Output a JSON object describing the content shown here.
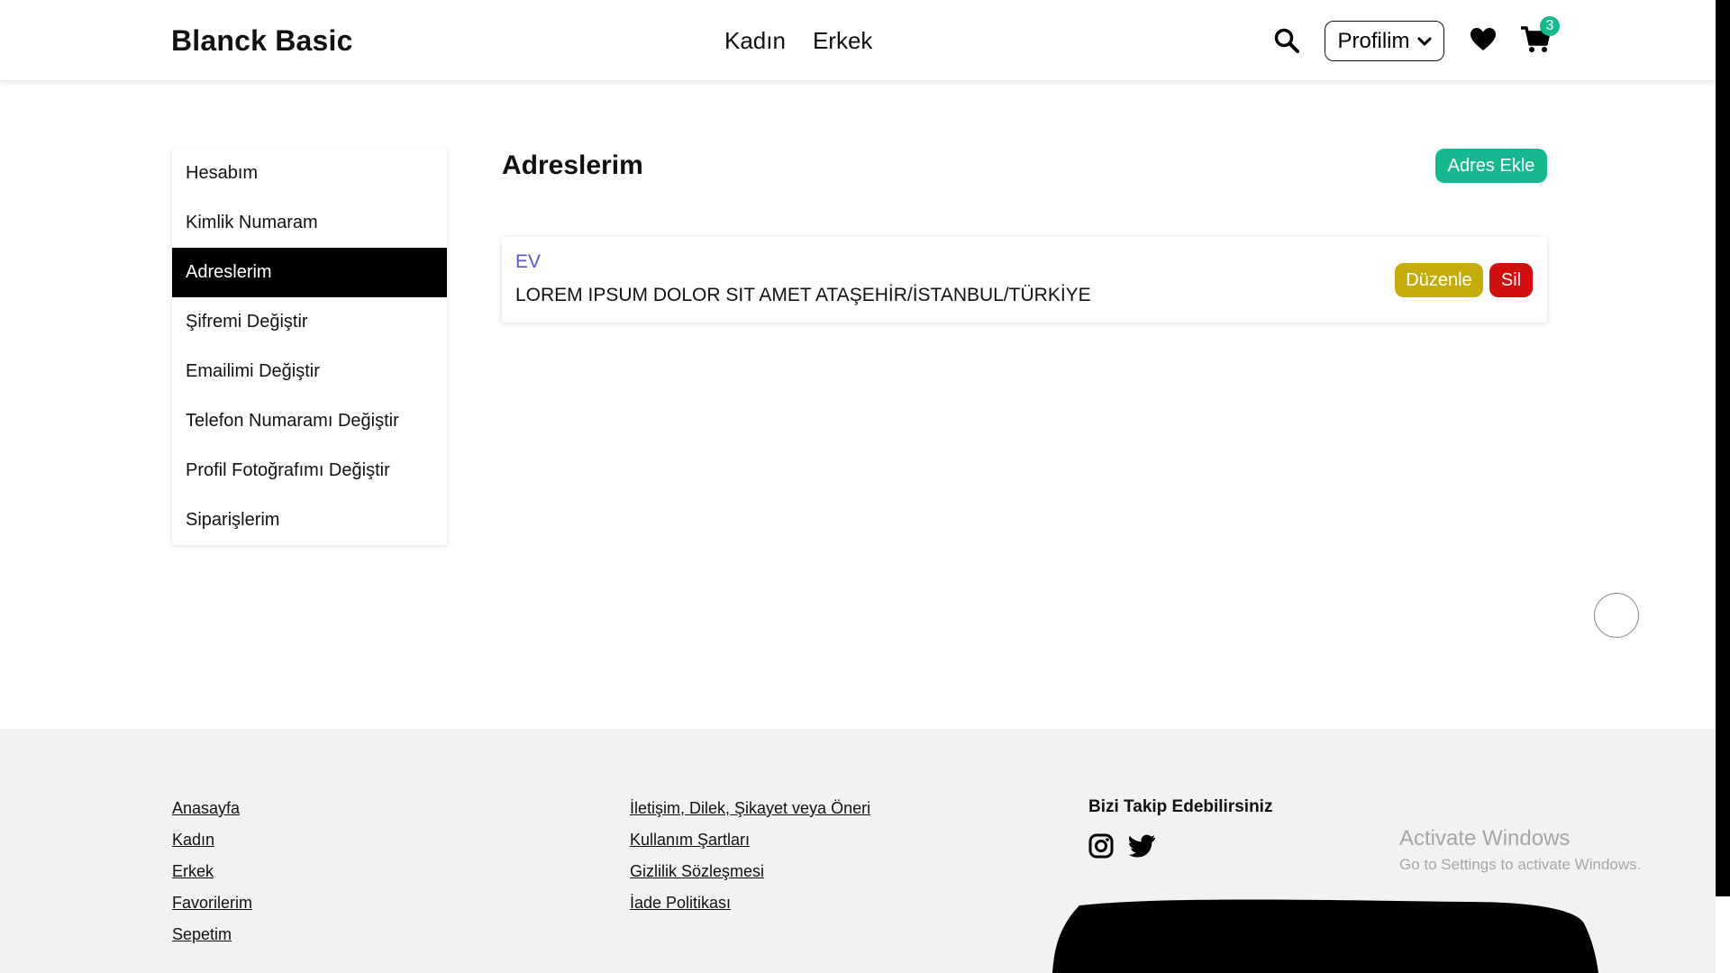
{
  "header": {
    "brand": "Blanck Basic",
    "nav": [
      "Kadın",
      "Erkek"
    ],
    "profile_label": "Profilim",
    "cart_count": "3",
    "icons": {
      "search": "search-icon",
      "favorites": "heart-icon",
      "cart": "cart-icon",
      "dropdown": "chevron-down-icon"
    }
  },
  "sidebar": {
    "items": [
      {
        "label": "Hesabım"
      },
      {
        "label": "Kimlik Numaram"
      },
      {
        "label": "Adreslerim"
      },
      {
        "label": "Şifremi Değiştir"
      },
      {
        "label": "Emailimi Değiştir"
      },
      {
        "label": "Telefon Numaramı Değiştir"
      },
      {
        "label": "Profil Fotoğrafımı Değiştir"
      },
      {
        "label": "Siparişlerim"
      }
    ],
    "active_label": "Adreslerim"
  },
  "main": {
    "title": "Adreslerim",
    "add_button": "Adres Ekle",
    "addresses": [
      {
        "label": "EV",
        "text": "LOREM IPSUM DOLOR SIT AMET ATAŞEHİR/İSTANBUL/TÜRKİYE",
        "edit": "Düzenle",
        "delete": "Sil"
      }
    ]
  },
  "footer": {
    "col1": [
      "Anasayfa",
      "Kadın",
      "Erkek",
      "Favorilerim",
      "Sepetim"
    ],
    "col2": [
      "İletişim, Dilek, Şikayet veya Öneri",
      "Kullanım Şartları",
      "Gizlilik Sözleşmesi",
      "İade Politikası"
    ],
    "follow_title": "Bizi Takip Edebilirsiniz",
    "social": [
      "instagram-icon",
      "twitter-icon"
    ]
  },
  "watermark": {
    "title": "Activate Windows",
    "subtitle": "Go to Settings to activate Windows."
  },
  "colors": {
    "accent_green": "#16b98f",
    "edit_yellow": "#c4ad0a",
    "delete_red": "#d20f0f",
    "address_label": "#5856d6",
    "footer_bg": "#f2f2f2"
  }
}
